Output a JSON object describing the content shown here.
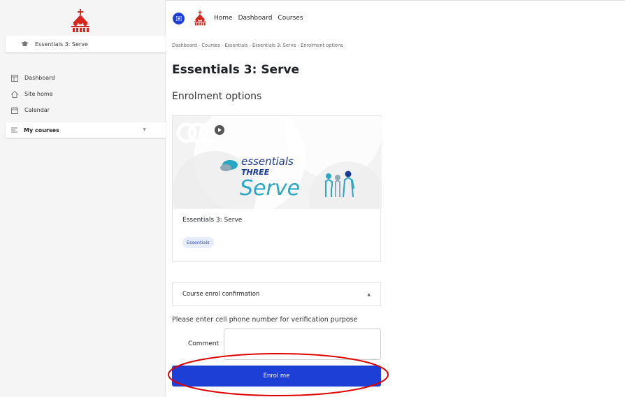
{
  "sidebar": {
    "course_label": "Essentials 3: Serve",
    "items": [
      {
        "label": "Dashboard",
        "icon": "dashboard-icon"
      },
      {
        "label": "Site home",
        "icon": "home-icon"
      },
      {
        "label": "Calendar",
        "icon": "calendar-icon"
      }
    ],
    "my_courses": "My courses"
  },
  "topbar": {
    "links": [
      "Home",
      "Dashboard",
      "Courses"
    ]
  },
  "breadcrumb": [
    "Dashboard",
    "Courses",
    "Essentials",
    "Essentials 3: Serve",
    "Enrolment options"
  ],
  "page": {
    "title": "Essentials 3: Serve",
    "subtitle": "Enrolment options"
  },
  "course": {
    "name": "Essentials 3: Serve",
    "badge": "Essentials",
    "image_text_1": "essentials",
    "image_text_2": "THREE",
    "image_text_3": "Serve"
  },
  "enrol": {
    "section_title": "Course enrol confirmation",
    "help_text": "Please enter cell phone number for verification purpose",
    "comment_label": "Comment",
    "comment_value": "",
    "button_label": "Enrol me"
  },
  "colors": {
    "accent": "#1e3fd6",
    "logo": "#d7261e",
    "image_teal": "#2aa7c3",
    "image_navy": "#1a3b8f",
    "highlight": "#e00000"
  }
}
